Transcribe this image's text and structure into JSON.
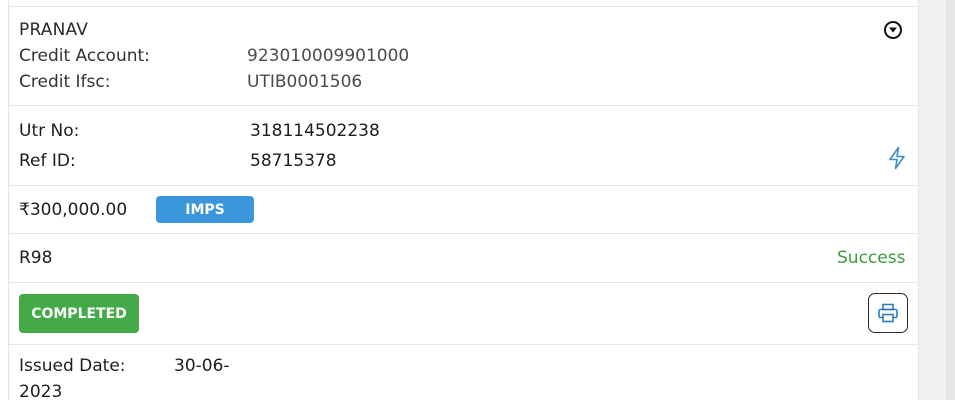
{
  "transaction": {
    "beneficiary_name": "PRANAV",
    "credit_account_label": "Credit Account:",
    "credit_account_value": "923010009901000",
    "credit_ifsc_label": "Credit Ifsc:",
    "credit_ifsc_value": "UTIB0001506",
    "utr_label": "Utr No:",
    "utr_value": "318114502238",
    "ref_label": "Ref ID:",
    "ref_value": "58715378",
    "amount": "₹300,000.00",
    "mode": "IMPS",
    "code": "R98",
    "result": "Success",
    "status_button": "COMPLETED",
    "issued_label": "Issued Date:",
    "issued_value_line1": "30-06-",
    "issued_value_line2": "2023"
  },
  "icons": {
    "expand": "chevron-down-icon",
    "action": "bolt-icon",
    "print": "printer-icon"
  },
  "colors": {
    "imps_badge": "#3b97dc",
    "completed_button": "#43aa47",
    "success_text": "#3d9a3d",
    "bolt_icon": "#3b8fd1",
    "printer_icon": "#2e7dbb"
  }
}
